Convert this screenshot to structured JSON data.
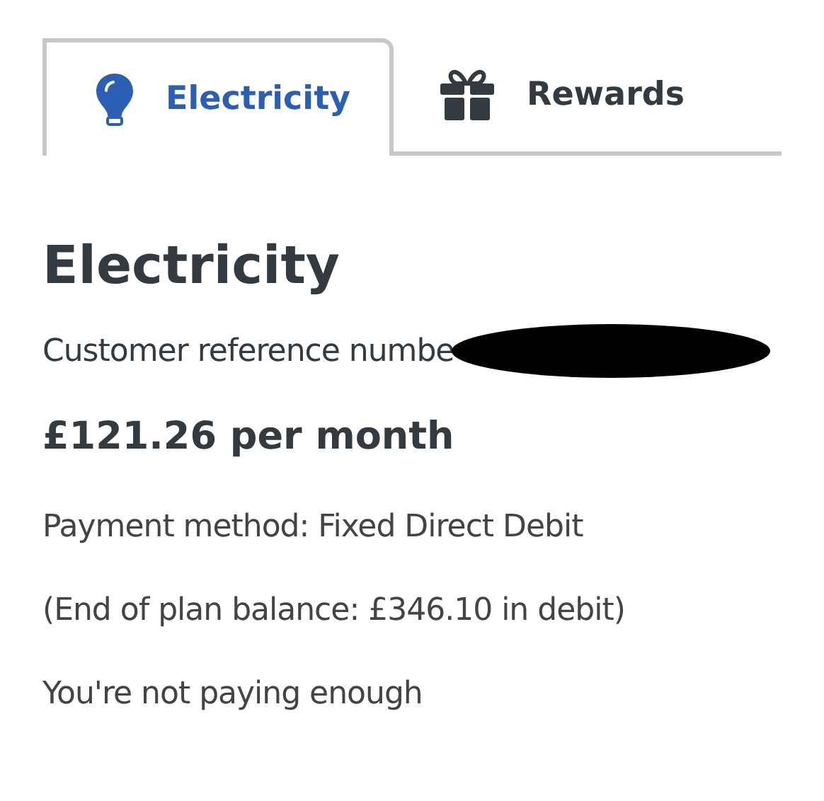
{
  "tabs": [
    {
      "label": "Electricity",
      "kind": "bulb",
      "selected": true
    },
    {
      "label": "Rewards",
      "kind": "gift",
      "selected": false
    }
  ],
  "heading": "Electricity",
  "reference_label": "Customer reference numbe",
  "reference_redacted": true,
  "amount": "£121.26 per month",
  "details": [
    "Payment method: Fixed Direct Debit",
    "(End of plan balance: £346.10 in debit)",
    "You're not paying enough"
  ]
}
